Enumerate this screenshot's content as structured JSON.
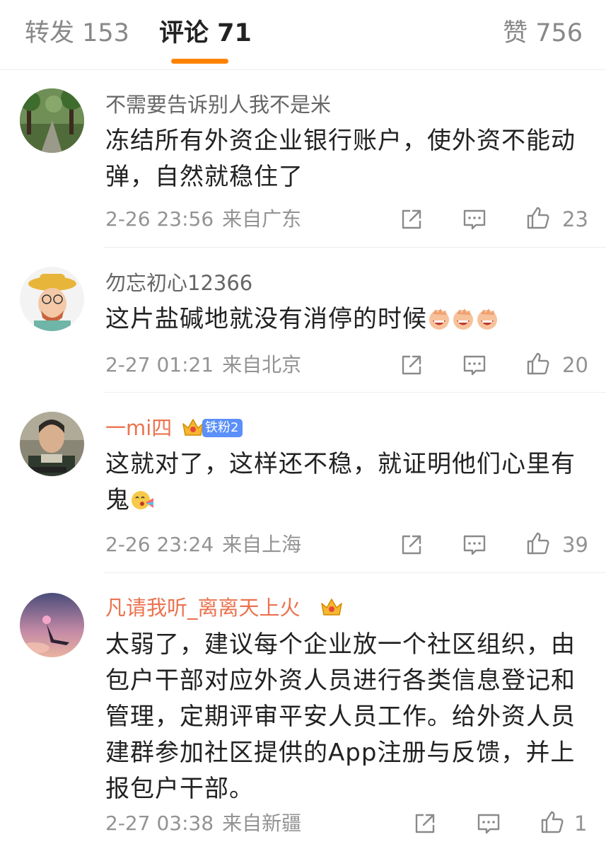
{
  "tabs": {
    "repost": "转发 153",
    "comment": "评论 71",
    "like": "赞 756",
    "accent": "#ff8200"
  },
  "comments": [
    {
      "username": "不需要告诉别人我不是米",
      "text": "冻结所有外资企业银行账户，使外资不能动弹，自然就稳住了",
      "date": "2-26 23:56",
      "location": "来自广东",
      "likes": "23"
    },
    {
      "username": "勿忘初心12366",
      "text": "这片盐碱地就没有消停的时候",
      "date": "2-27 01:21",
      "location": "来自北京",
      "likes": "20"
    },
    {
      "username": "一mi四",
      "badge": "铁粉2",
      "text": "这就对了，这样还不稳，就证明他们心里有鬼",
      "date": "2-26 23:24",
      "location": "来自上海",
      "likes": "39"
    },
    {
      "username": "凡请我听_离离天上火",
      "text": "太弱了，建议每个企业放一个社区组织，由包户干部对应外资人员进行各类信息登记和管理，定期评审平安人员工作。给外资人员建群参加社区提供的App注册与反馈，并上报包户干部。",
      "date": "2-27 03:38",
      "location": "来自新疆",
      "likes": "1"
    }
  ],
  "icons": {
    "share": "share-icon",
    "reply": "comment-icon",
    "like": "thumbs-up-icon"
  }
}
